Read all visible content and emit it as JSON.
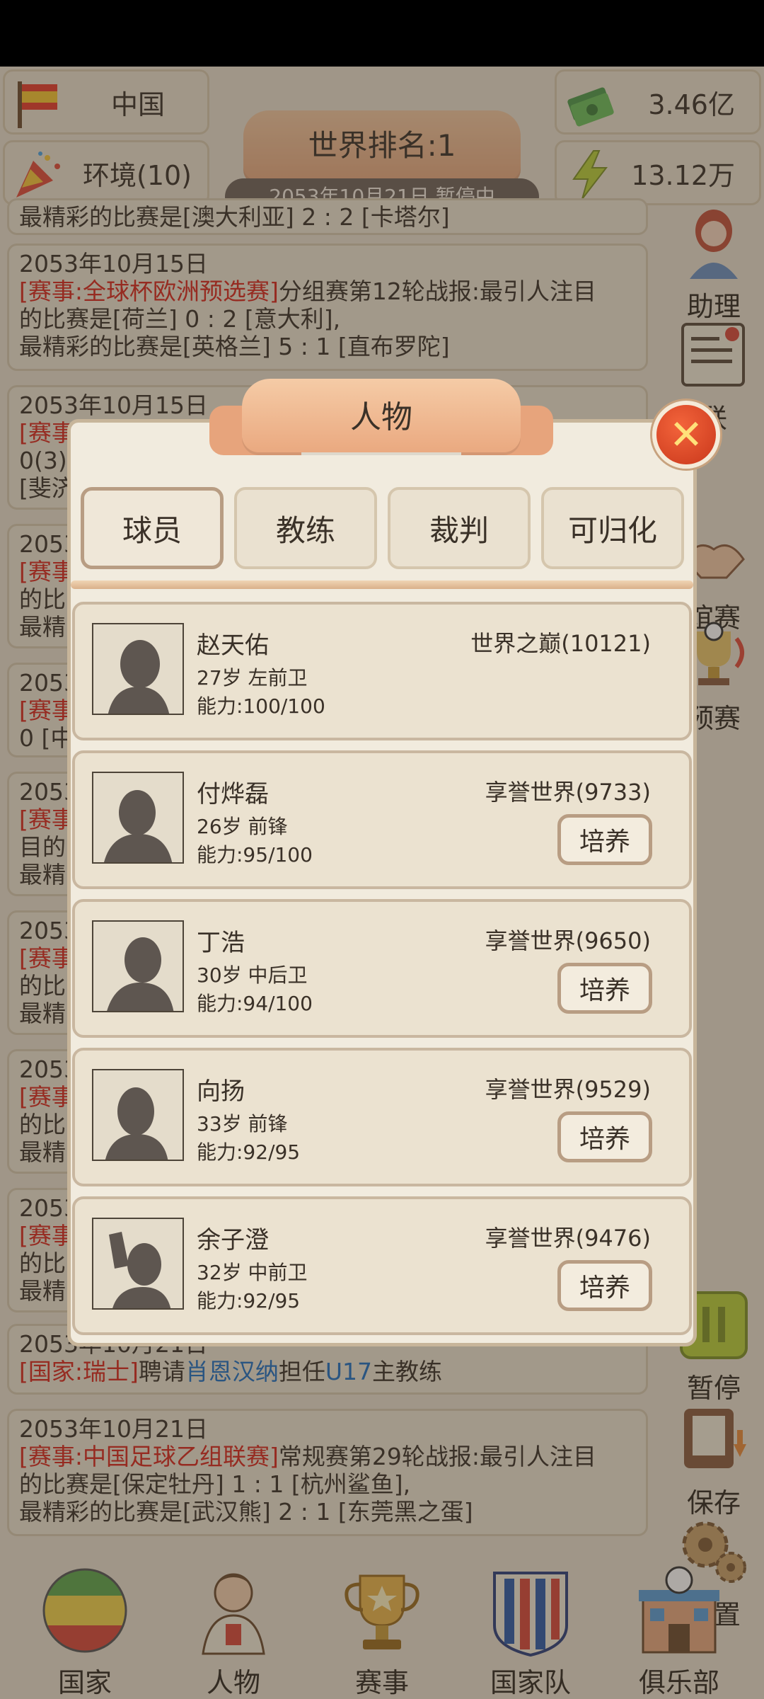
{
  "header": {
    "country": "中国",
    "environment": "环境(10)",
    "money": "3.46亿",
    "energy": "13.12万",
    "world_rank": "世界排名:1",
    "date_status": "2053年10月21日 暂停中"
  },
  "side_menu": [
    {
      "label": "助理",
      "icon": "assistant-icon"
    },
    {
      "label": "联",
      "icon": "league-icon"
    },
    {
      "label": "谊赛",
      "icon": "friendly-match-icon"
    },
    {
      "label": "预赛",
      "icon": "qualifier-icon"
    },
    {
      "label": "暂停",
      "icon": "pause-icon"
    },
    {
      "label": "保存",
      "icon": "save-icon"
    },
    {
      "label": "设置",
      "icon": "settings-icon"
    }
  ],
  "news": [
    {
      "lines": [
        "最精彩的比赛是[澳大利亚] 2 : 2 [卡塔尔]"
      ]
    },
    {
      "date": "2053年10月15日",
      "tag": "[赛事:全球杯欧洲预选赛]",
      "text": "分组赛第12轮战报:最引人注目",
      "lines": [
        "的比赛是[荷兰] 0 : 2 [意大利],",
        "最精彩的比赛是[英格兰] 5 : 1 [直布罗陀]"
      ]
    },
    {
      "date": "2053年10月15日",
      "tag": "[赛事",
      "lines": [
        "0(3)",
        "[斐济"
      ]
    },
    {
      "date": "2053",
      "tag": "[赛事",
      "lines": [
        "的比",
        "最精"
      ]
    },
    {
      "date": "2053",
      "tag": "[赛事",
      "lines": [
        "0 [中"
      ]
    },
    {
      "date": "2053",
      "tag": "[赛事",
      "lines": [
        "目的",
        "最精"
      ]
    },
    {
      "date": "2053",
      "tag": "[赛事",
      "lines": [
        "的比",
        "最精"
      ]
    },
    {
      "date": "2053",
      "tag": "[赛事",
      "lines": [
        "的比",
        "最精"
      ]
    },
    {
      "date": "2053",
      "tag": "[赛事",
      "lines": [
        "的比",
        "最精"
      ]
    },
    {
      "date": "2053年10月21日",
      "tag": "[国家:瑞士]",
      "text1": "聘请",
      "link1": "肖恩汉纳",
      "text2": "担任",
      "link2": "U17",
      "text3": "主教练"
    },
    {
      "date": "2053年10月21日",
      "tag": "[赛事:中国足球乙组联赛]",
      "text": "常规赛第29轮战报:最引人注目",
      "lines": [
        "的比赛是[保定牡丹] 1 : 1 [杭州鲨鱼],",
        "最精彩的比赛是[武汉熊] 2 : 1 [东莞黑之蛋]"
      ]
    }
  ],
  "bottom_nav": [
    {
      "label": "国家",
      "icon": "country-flag-icon"
    },
    {
      "label": "人物",
      "icon": "person-icon"
    },
    {
      "label": "赛事",
      "icon": "trophy-icon"
    },
    {
      "label": "国家队",
      "icon": "national-team-icon"
    },
    {
      "label": "俱乐部",
      "icon": "club-icon"
    }
  ],
  "modal": {
    "title": "人物",
    "tabs": [
      "球员",
      "教练",
      "裁判",
      "可归化"
    ],
    "active_tab": "球员",
    "train_label": "培养",
    "players": [
      {
        "name": "赵天佑",
        "age_pos": "27岁 左前卫",
        "ability": "能力:100/100",
        "rank": "世界之巅(10121)",
        "trainable": false
      },
      {
        "name": "付烨磊",
        "age_pos": "26岁 前锋",
        "ability": "能力:95/100",
        "rank": "享誉世界(9733)",
        "trainable": true
      },
      {
        "name": "丁浩",
        "age_pos": "30岁 中后卫",
        "ability": "能力:94/100",
        "rank": "享誉世界(9650)",
        "trainable": true
      },
      {
        "name": "向扬",
        "age_pos": "33岁 前锋",
        "ability": "能力:92/95",
        "rank": "享誉世界(9529)",
        "trainable": true
      },
      {
        "name": "余子澄",
        "age_pos": "32岁 中前卫",
        "ability": "能力:92/95",
        "rank": "享誉世界(9476)",
        "trainable": true
      }
    ]
  },
  "colors": {
    "accent_red": "#d8261c",
    "link_blue": "#1e6fc1",
    "background": "#e8dfcd"
  }
}
